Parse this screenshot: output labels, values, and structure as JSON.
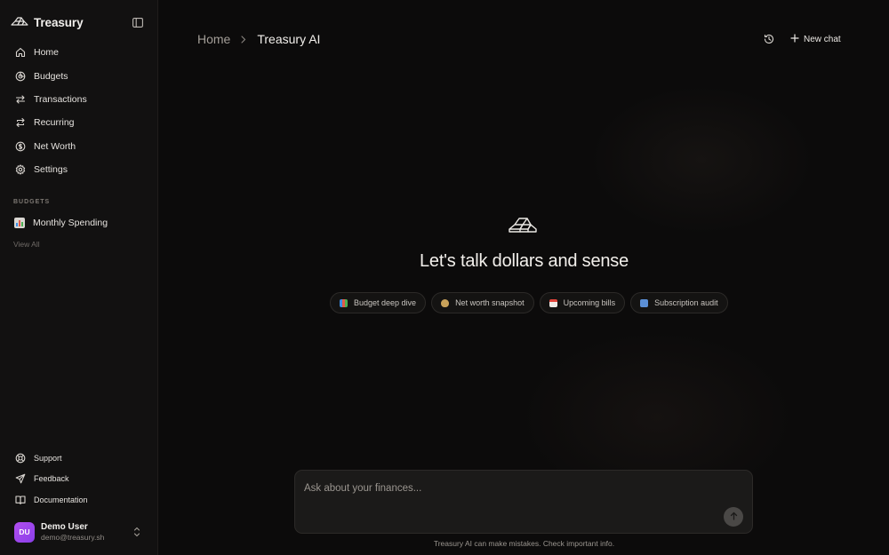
{
  "brand": {
    "name": "Treasury"
  },
  "sidebar": {
    "nav": [
      {
        "label": "Home",
        "icon": "home-icon"
      },
      {
        "label": "Budgets",
        "icon": "pie-chart-icon"
      },
      {
        "label": "Transactions",
        "icon": "arrows-icon"
      },
      {
        "label": "Recurring",
        "icon": "repeat-icon"
      },
      {
        "label": "Net Worth",
        "icon": "dollar-circle-icon"
      },
      {
        "label": "Settings",
        "icon": "gear-icon"
      }
    ],
    "budgets_label": "BUDGETS",
    "budgets": [
      {
        "label": "Monthly Spending",
        "icon": "bar-chart-emoji"
      }
    ],
    "view_all": "View All",
    "bottom": [
      {
        "label": "Support",
        "icon": "lifebuoy-icon"
      },
      {
        "label": "Feedback",
        "icon": "send-icon"
      },
      {
        "label": "Documentation",
        "icon": "book-icon"
      }
    ],
    "user": {
      "initials": "DU",
      "name": "Demo User",
      "email": "demo@treasury.sh"
    }
  },
  "header": {
    "breadcrumb": {
      "home": "Home",
      "current": "Treasury AI"
    },
    "new_chat": "New chat"
  },
  "hero": {
    "title": "Let's talk dollars and sense"
  },
  "chips": [
    {
      "label": "Budget deep dive",
      "icon": "bar-chart-emoji"
    },
    {
      "label": "Net worth snapshot",
      "icon": "money-bag-emoji"
    },
    {
      "label": "Upcoming bills",
      "icon": "calendar-emoji"
    },
    {
      "label": "Subscription audit",
      "icon": "repeat-emoji"
    }
  ],
  "composer": {
    "placeholder": "Ask about your finances..."
  },
  "disclaimer": "Treasury AI can make mistakes. Check important info.",
  "colors": {
    "avatar": "#9b46ee",
    "background": "#0c0b0b",
    "sidebar": "#121111"
  }
}
